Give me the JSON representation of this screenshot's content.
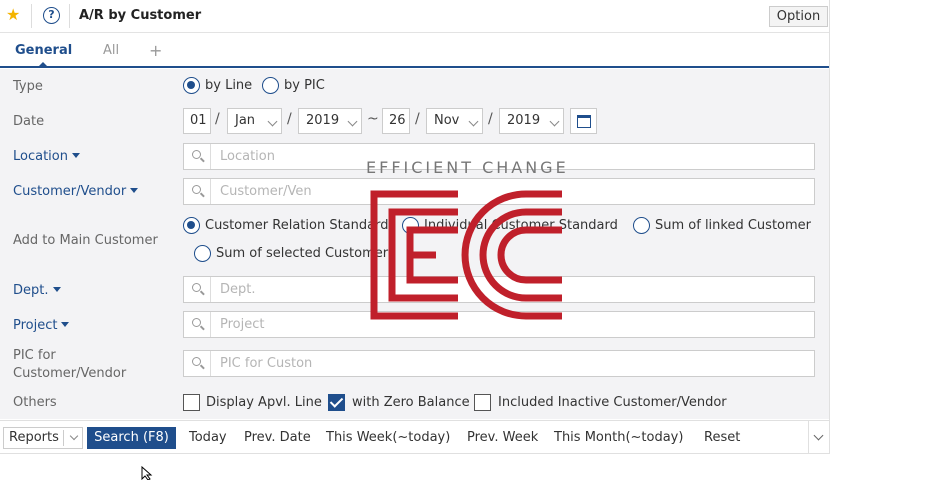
{
  "header": {
    "title": "A/R by Customer",
    "option_label": "Option"
  },
  "tabs": [
    {
      "label": "General"
    },
    {
      "label": "All"
    },
    {
      "label": "+"
    }
  ],
  "form": {
    "type": {
      "label": "Type",
      "options": [
        "by Line",
        "by PIC"
      ],
      "selected": "by Line"
    },
    "date": {
      "label": "Date",
      "from": {
        "day": "01",
        "month": "Jan",
        "year": "2019"
      },
      "to": {
        "day": "26",
        "month": "Nov",
        "year": "2019"
      },
      "separator": "/",
      "range_sep": "~"
    },
    "location": {
      "label": "Location",
      "placeholder": "Location"
    },
    "customer_vendor": {
      "label": "Customer/Vendor",
      "placeholder": "Customer/Ven"
    },
    "add_to_main": {
      "label": "Add to Main Customer",
      "options": [
        "Customer Relation Standard",
        "Individual Customer Standard",
        "Sum of linked Customer",
        "Sum of selected Customer"
      ],
      "selected": "Customer Relation Standard"
    },
    "dept": {
      "label": "Dept.",
      "placeholder": "Dept."
    },
    "project": {
      "label": "Project",
      "placeholder": "Project"
    },
    "pic": {
      "label_line1": "PIC for",
      "label_line2": "Customer/Vendor",
      "placeholder": "PIC for Custon"
    },
    "others": {
      "label": "Others",
      "checks": [
        {
          "label": "Display Apvl. Line",
          "checked": false
        },
        {
          "label": "with Zero Balance",
          "checked": true
        },
        {
          "label": "Included Inactive Customer/Vendor",
          "checked": false
        }
      ]
    }
  },
  "bottom": {
    "reports_label": "Reports",
    "search_label": "Search (F8)",
    "quick": [
      "Today",
      "Prev. Date",
      "This Week(~today)",
      "Prev. Week",
      "This Month(~today)",
      "Reset"
    ]
  },
  "watermark": {
    "text": "EFFICIENT CHANGE",
    "color": "#c0202b"
  },
  "colors": {
    "accent": "#1f4e8c",
    "star": "#f4b400"
  }
}
